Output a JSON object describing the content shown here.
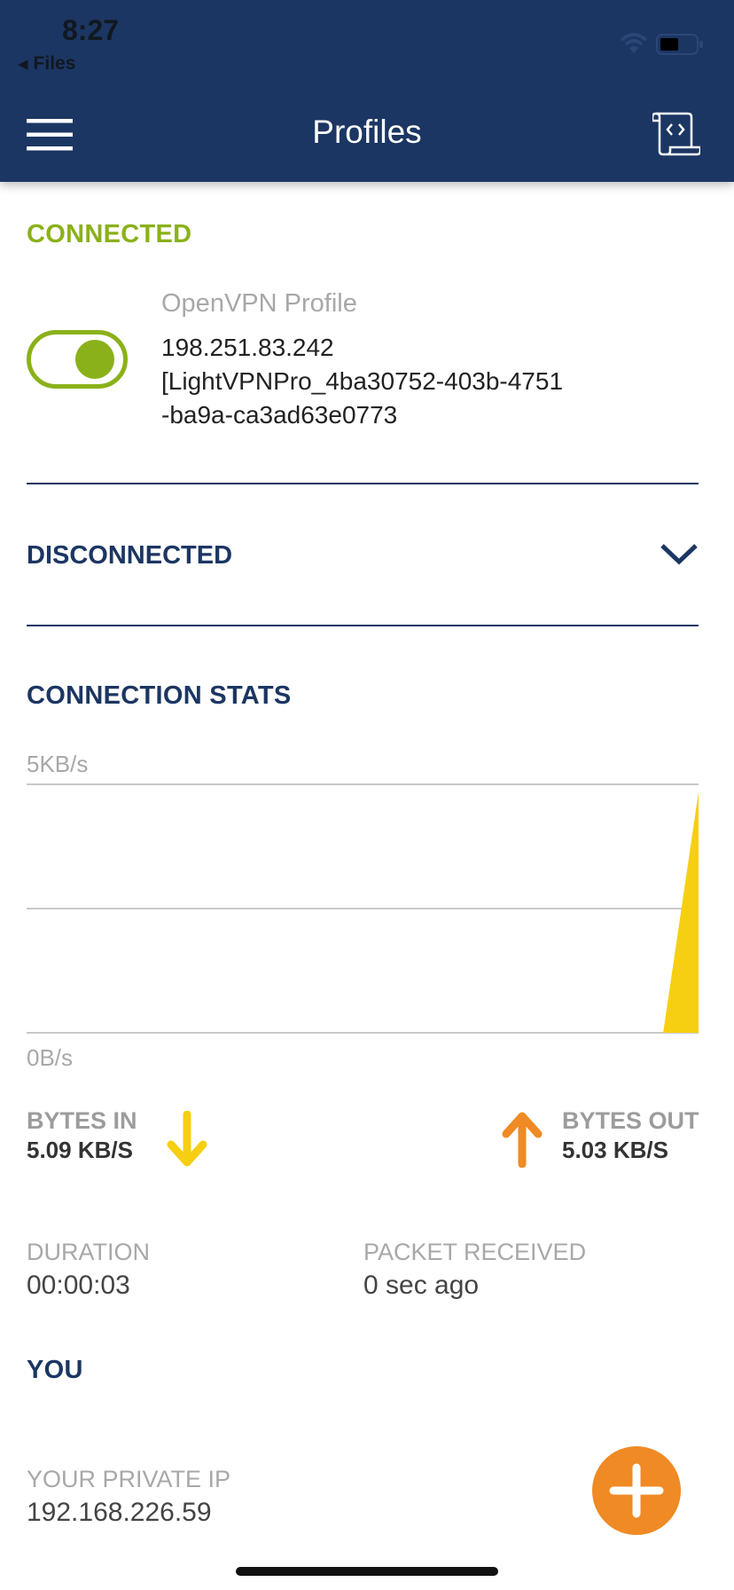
{
  "status_bar": {
    "time": "8:27",
    "back_label": "Files"
  },
  "header": {
    "title": "Profiles"
  },
  "connected": {
    "label": "CONNECTED",
    "toggle_on": true,
    "profile_name": "OpenVPN Profile",
    "address": "198.251.83.242",
    "profile_id_line1": "[LightVPNPro_4ba30752-403b-4751",
    "profile_id_line2": "-ba9a-ca3ad63e0773"
  },
  "disconnected": {
    "label": "DISCONNECTED"
  },
  "stats": {
    "label": "CONNECTION STATS",
    "chart_max_label": "5KB/s",
    "chart_min_label": "0B/s",
    "bytes_in_label": "BYTES IN",
    "bytes_in_value": "5.09 KB/S",
    "bytes_out_label": "BYTES OUT",
    "bytes_out_value": "5.03 KB/S",
    "duration_label": "DURATION",
    "duration_value": "00:00:03",
    "packet_label": "PACKET RECEIVED",
    "packet_value": "0 sec ago"
  },
  "you": {
    "label": "YOU",
    "private_ip_label": "YOUR PRIVATE IP",
    "private_ip_value": "192.168.226.59"
  },
  "chart_data": {
    "type": "area",
    "ylim": [
      0,
      5
    ],
    "grid": true,
    "series": [
      {
        "values": [
          0,
          0,
          0,
          0,
          0,
          0,
          0,
          0,
          0,
          0,
          0,
          0,
          0,
          0,
          0,
          0,
          0,
          0,
          0,
          4.85
        ]
      }
    ]
  },
  "colors": {
    "header_bg": "#1c3663",
    "connected_green": "#8bb11a",
    "bytes_in_yellow": "#f6cf12",
    "bytes_out_orange": "#ef8a24",
    "fab_orange": "#ef8a24"
  },
  "icons": {
    "menu": "menu-icon",
    "log": "log-document-icon",
    "chevron": "chevron-down-icon",
    "bytes_in": "arrow-down-icon",
    "bytes_out": "arrow-up-icon",
    "fab": "plus-icon"
  }
}
